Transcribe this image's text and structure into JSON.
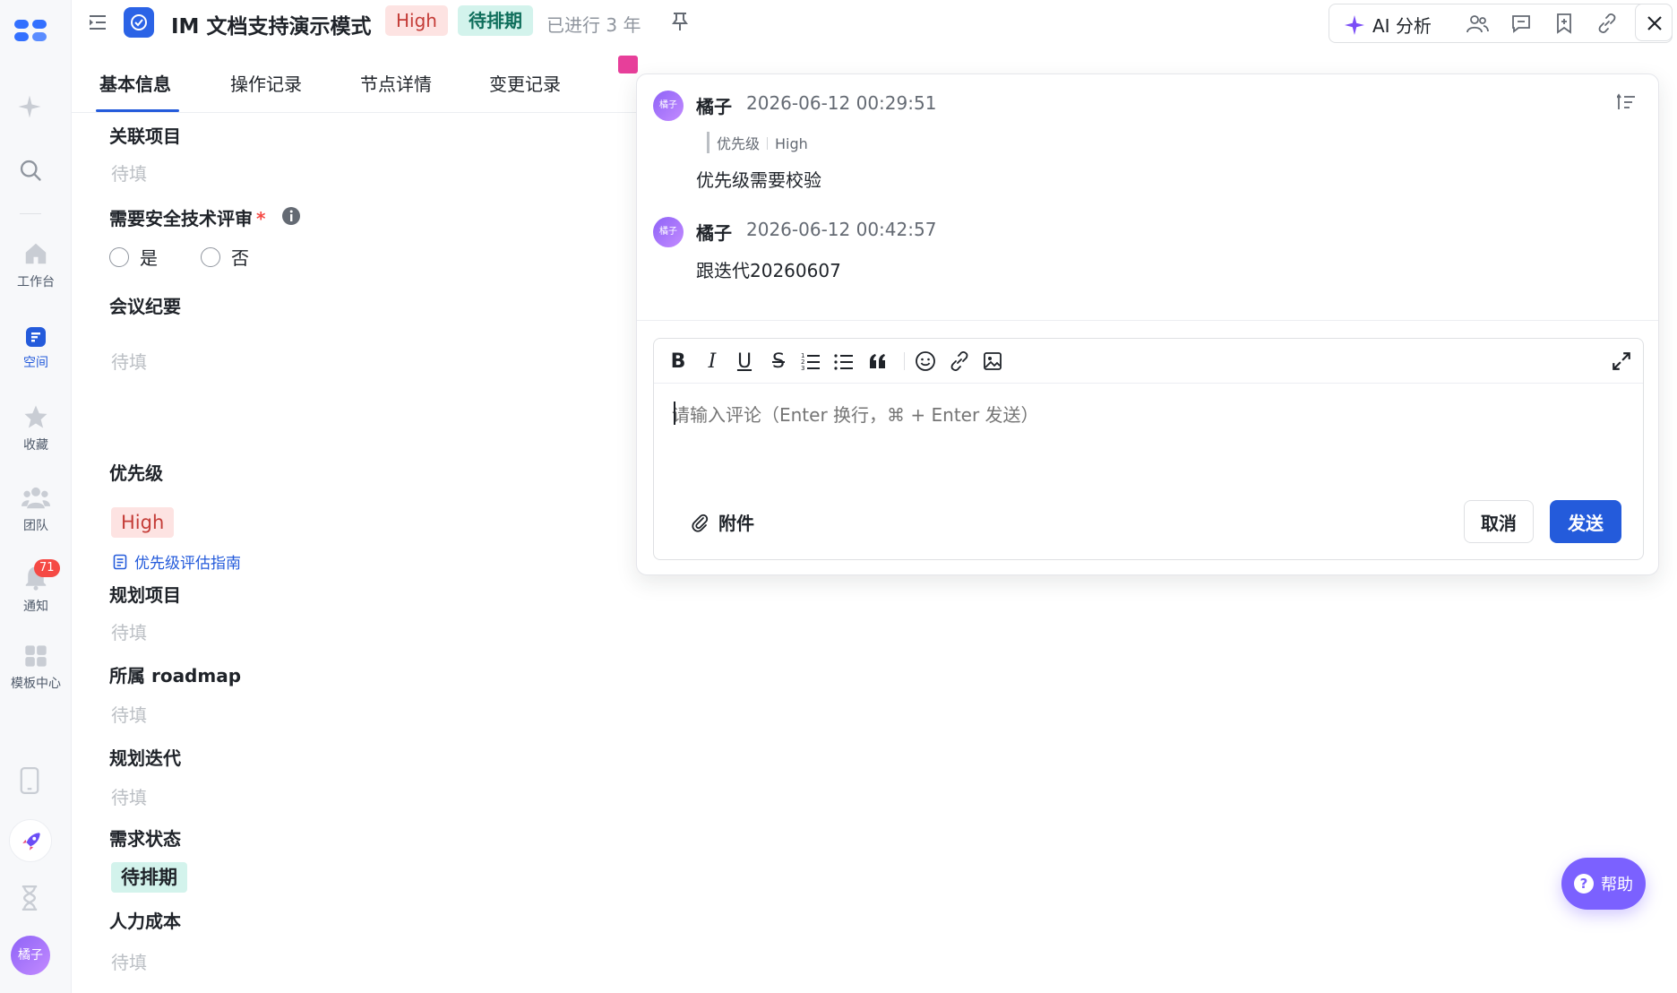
{
  "rail": {
    "items": [
      {
        "label": "工作台"
      },
      {
        "label": "空间"
      },
      {
        "label": "收藏"
      },
      {
        "label": "团队"
      },
      {
        "label": "通知",
        "badge": "71"
      },
      {
        "label": "模板中心"
      }
    ],
    "user_avatar": "橘子"
  },
  "header": {
    "title": "IM 文档支持演示模式",
    "priority_tag": "High",
    "status_tag": "待排期",
    "elapsed": "已进行 3 年",
    "ai_label": "AI 分析"
  },
  "tabs": [
    {
      "label": "基本信息"
    },
    {
      "label": "操作记录"
    },
    {
      "label": "节点详情"
    },
    {
      "label": "变更记录"
    }
  ],
  "form": {
    "related_project": {
      "label": "关联项目",
      "value": "待填"
    },
    "security_review": {
      "label": "需要安全技术评审",
      "required_mark": "*",
      "option_yes": "是",
      "option_no": "否"
    },
    "meeting_notes": {
      "label": "会议纪要",
      "value": "待填"
    },
    "priority": {
      "label": "优先级",
      "value": "High",
      "guide_link": "优先级评估指南"
    },
    "planning_project": {
      "label": "规划项目",
      "value": "待填"
    },
    "roadmap": {
      "label": "所属 roadmap",
      "value": "待填"
    },
    "planning_iteration": {
      "label": "规划迭代",
      "value": "待填"
    },
    "requirement_status": {
      "label": "需求状态",
      "value": "待排期"
    },
    "labor_cost": {
      "label": "人力成本",
      "value": "待填"
    }
  },
  "comments": [
    {
      "avatar": "橘子",
      "author": "橘子",
      "time": "2026-06-12 00:29:51",
      "quote_field": "优先级",
      "quote_value": "High",
      "body": "优先级需要校验"
    },
    {
      "avatar": "橘子",
      "author": "橘子",
      "time": "2026-06-12 00:42:57",
      "body": "跟迭代20260607"
    }
  ],
  "editor": {
    "placeholder": "请输入评论（Enter 换行，⌘ + Enter 发送）",
    "attach_label": "附件",
    "cancel_label": "取消",
    "send_label": "发送"
  },
  "help_label": "帮助",
  "colors": {
    "accent": "#245bdb",
    "high_tag_bg": "#fde3e2",
    "pending_tag_bg": "#d3f3ec",
    "help_bg": "#7b61ff"
  }
}
